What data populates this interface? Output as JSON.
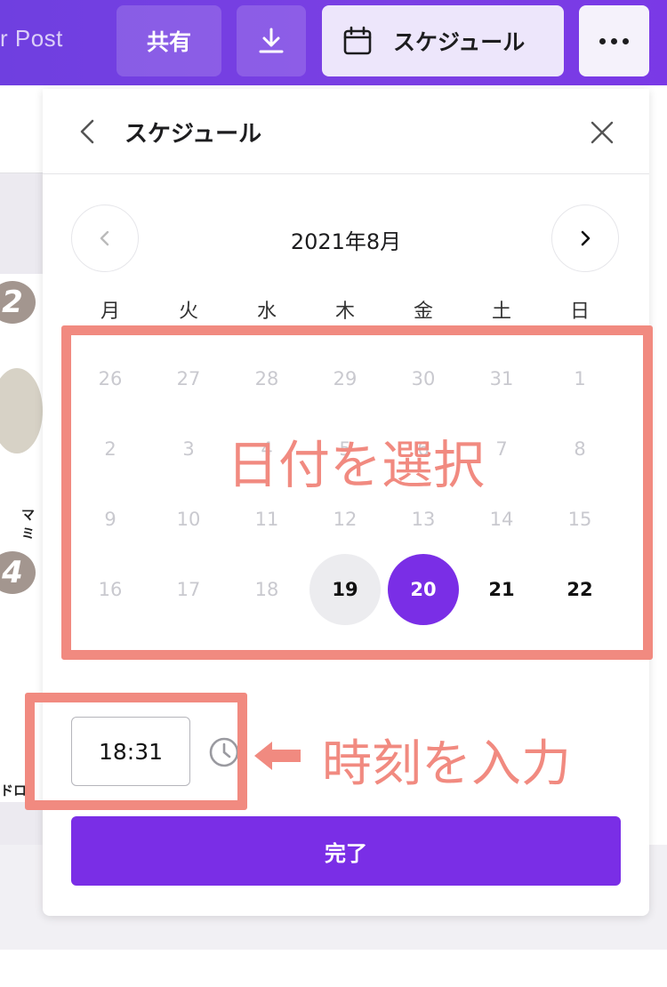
{
  "topbar": {
    "title_fragment": "r Post",
    "share_label": "共有",
    "download_icon": "download-icon",
    "schedule_label": "スケジュール",
    "schedule_icon": "calendar-icon",
    "more_icon": "more-dots-icon"
  },
  "background": {
    "badge_top": "2",
    "badge_bottom": "4",
    "text_frag_1": "マミ",
    "text_frag_2": "ドロ"
  },
  "panel": {
    "title": "スケジュール",
    "back_icon": "chevron-left-icon",
    "close_icon": "close-icon",
    "month_label": "2021年8月",
    "prev_icon": "chevron-left-icon",
    "next_icon": "chevron-right-icon",
    "weekdays": [
      "月",
      "火",
      "水",
      "木",
      "金",
      "土",
      "日"
    ],
    "weeks": [
      [
        "26",
        "27",
        "28",
        "29",
        "30",
        "31",
        "1"
      ],
      [
        "2",
        "3",
        "4",
        "5",
        "6",
        "7",
        "8"
      ],
      [
        "9",
        "10",
        "11",
        "12",
        "13",
        "14",
        "15"
      ],
      [
        "16",
        "17",
        "18",
        "19",
        "20",
        "21",
        "22"
      ]
    ],
    "today_day": "19",
    "selected_day": "20",
    "enabled_days": [
      "19",
      "20",
      "21",
      "22"
    ],
    "time_value": "18:31",
    "done_label": "完了"
  },
  "annotations": {
    "select_date": "日付を選択",
    "enter_time": "時刻を入力"
  },
  "colors": {
    "accent": "#7a2ee6",
    "annotation": "#f18a80"
  }
}
